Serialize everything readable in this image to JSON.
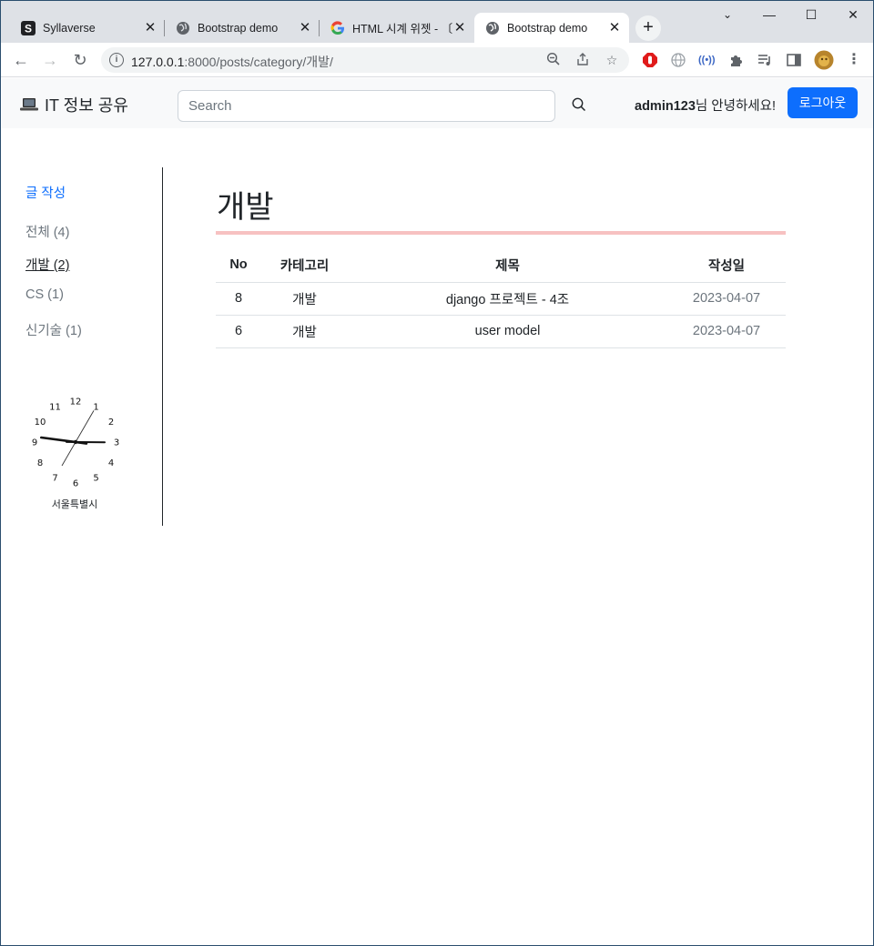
{
  "browser": {
    "tabs": [
      {
        "label": "Syllaverse",
        "icon": "s-logo-icon"
      },
      {
        "label": "Bootstrap demo",
        "icon": "globe-icon"
      },
      {
        "label": "HTML 시계 위젯 - 〔",
        "icon": "google-icon"
      },
      {
        "label": "Bootstrap demo",
        "icon": "globe-icon",
        "active": true
      }
    ],
    "address": {
      "host": "127.0.0.1",
      "path": ":8000/posts/category/개발/"
    },
    "window_controls": {
      "minimize": "—",
      "maximize": "☐",
      "close": "✕"
    }
  },
  "navbar": {
    "brand": "IT 정보 공유",
    "search_placeholder": "Search",
    "user": "admin123",
    "greeting_suffix": "님 안녕하세요!",
    "logout_label": "로그아웃"
  },
  "sidebar": {
    "write_label": "글 작성",
    "categories": [
      {
        "label": "전체 (4)",
        "active": false
      },
      {
        "label": "개발 (2)",
        "active": true
      },
      {
        "label": "CS (1)",
        "active": false
      },
      {
        "label": "신기술 (1)",
        "active": false
      }
    ],
    "clock": {
      "numbers": [
        "12",
        "1",
        "2",
        "3",
        "4",
        "5",
        "6",
        "7",
        "8",
        "9",
        "10",
        "11"
      ],
      "time": {
        "hour": 9,
        "minute": 15,
        "second": 5
      },
      "city": "서울특별시"
    }
  },
  "main": {
    "title": "개발",
    "table": {
      "headers": [
        "No",
        "카테고리",
        "제목",
        "작성일"
      ],
      "rows": [
        {
          "no": "8",
          "category": "개발",
          "title": "django 프로젝트 - 4조",
          "date": "2023-04-07"
        },
        {
          "no": "6",
          "category": "개발",
          "title": "user model",
          "date": "2023-04-07"
        }
      ]
    }
  },
  "colors": {
    "primary": "#0d6efd",
    "title_rule": "#f7c1c1",
    "muted": "#6c757d"
  }
}
